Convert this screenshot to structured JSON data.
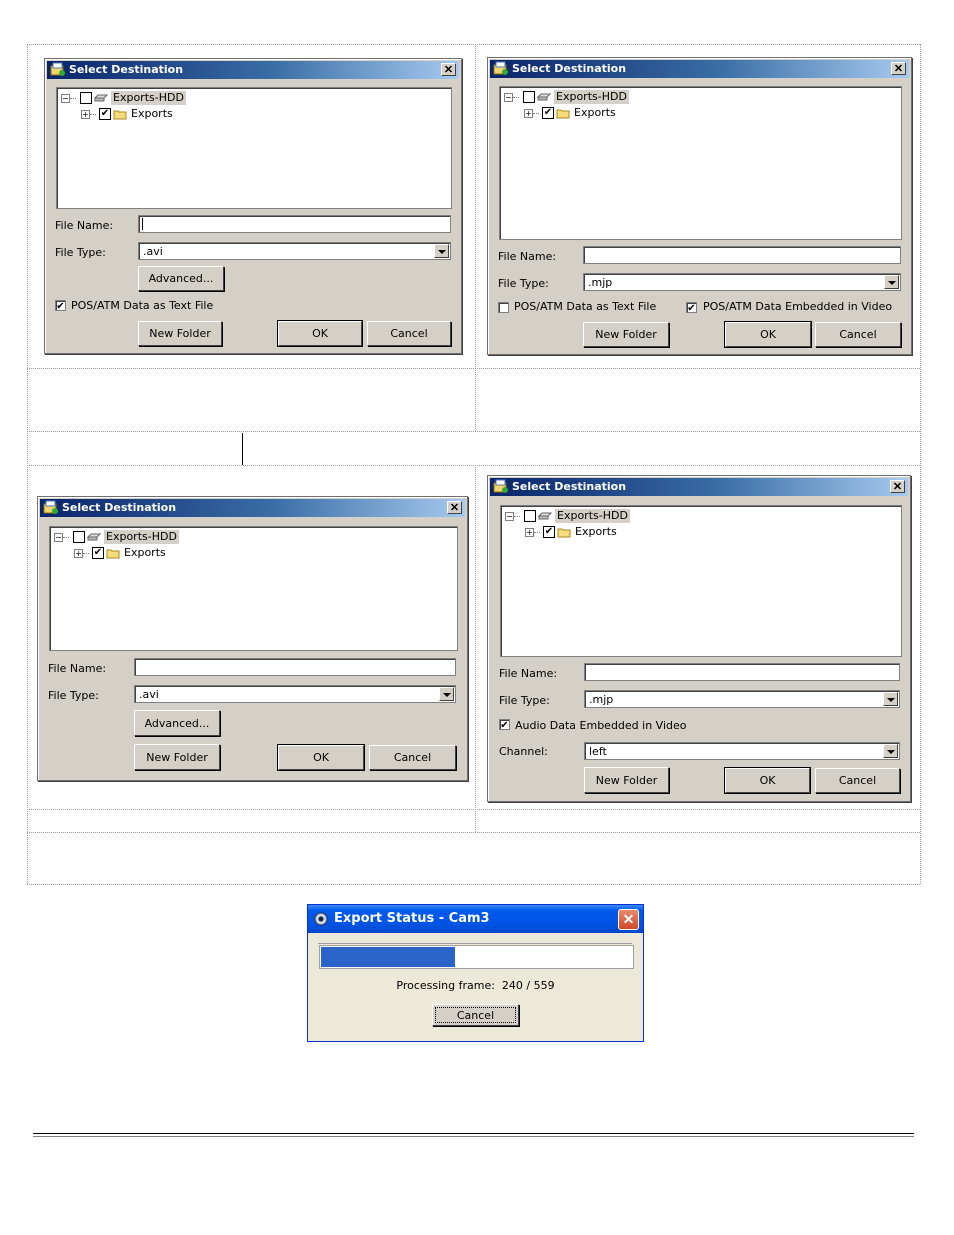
{
  "dialog_title": "Select Destination",
  "tree": {
    "root_label": "Exports-HDD",
    "child_label": "Exports",
    "root_checked": false,
    "child_checked": true
  },
  "labels": {
    "file_name": "File Name:",
    "file_type": "File Type:",
    "channel": "Channel:"
  },
  "buttons": {
    "advanced": "Advanced...",
    "new_folder": "New Folder",
    "ok": "OK",
    "cancel": "Cancel"
  },
  "dialogs": [
    {
      "id": "top-left",
      "file_name_value": "",
      "file_type_value": ".avi",
      "options": [
        {
          "label": "POS/ATM Data as Text File",
          "checked": true
        }
      ]
    },
    {
      "id": "top-right",
      "file_name_value": "",
      "file_type_value": ".mjp",
      "options": [
        {
          "label": "POS/ATM Data as Text File",
          "checked": false
        },
        {
          "label": "POS/ATM Data Embedded in Video",
          "checked": true
        }
      ]
    },
    {
      "id": "bottom-left",
      "file_name_value": "",
      "file_type_value": ".avi",
      "options": []
    },
    {
      "id": "bottom-right",
      "file_name_value": "",
      "file_type_value": ".mjp",
      "options": [
        {
          "label": "Audio Data Embedded in Video",
          "checked": true
        }
      ],
      "channel_value": "left"
    }
  ],
  "export_status": {
    "title": "Export Status - Cam3",
    "status_text": "Processing frame:  240 / 559",
    "progress": 0.43,
    "cancel_label": "Cancel",
    "title_bar_color": "#0054e3",
    "progress_color": "#2b64c8"
  }
}
